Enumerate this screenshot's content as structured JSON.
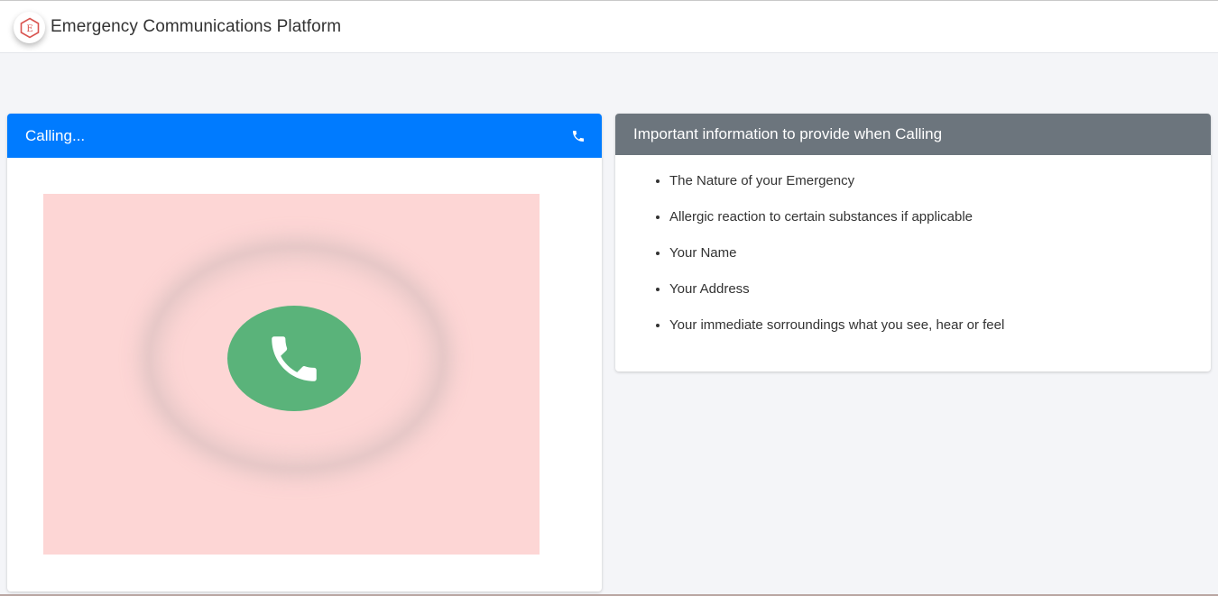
{
  "header": {
    "logo_letter": "E",
    "title": "Emergency Communications Platform"
  },
  "calling_card": {
    "title": "Calling...",
    "header_icon": "phone-icon",
    "call_icon": "phone-icon"
  },
  "info_card": {
    "title": "Important information to provide when Calling",
    "items": [
      "The Nature of your Emergency",
      "Allergic reaction to certain substances if applicable",
      "Your Name",
      "Your Address",
      "Your immediate sorroundings what you see, hear or feel"
    ]
  },
  "colors": {
    "primary": "#007bff",
    "secondary": "#6c757d",
    "call_bg": "#fdd6d5",
    "call_button": "#5ab37a",
    "logo_accent": "#d9534f"
  }
}
